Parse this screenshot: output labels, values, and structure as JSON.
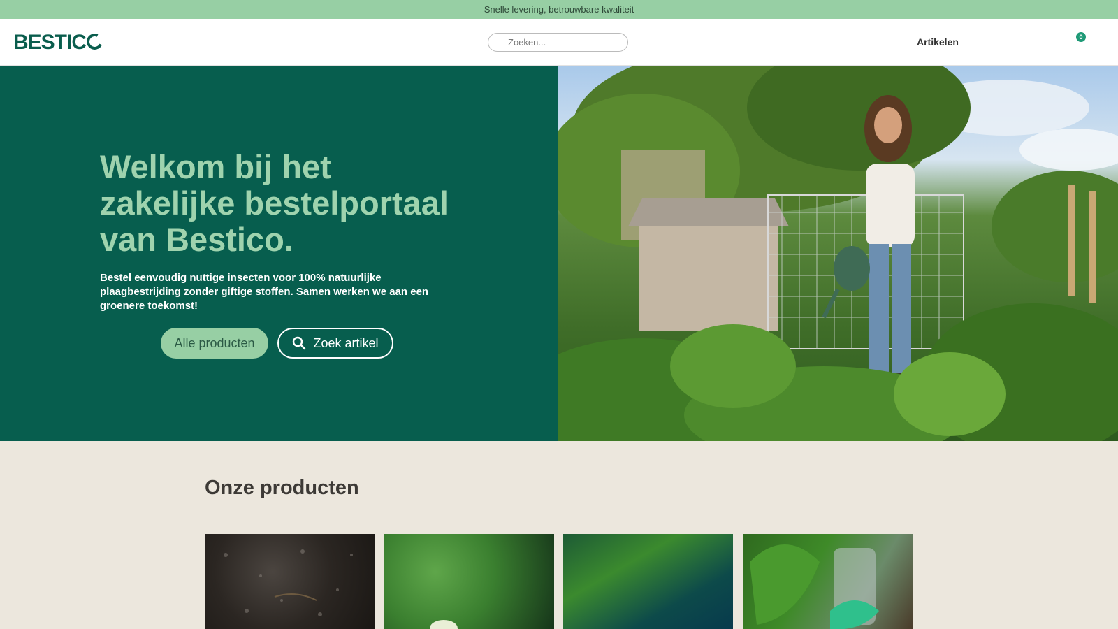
{
  "topbar": {
    "text": "Snelle levering, betrouwbare kwaliteit"
  },
  "header": {
    "logo": "BESTIC",
    "search_placeholder": "Zoeken...",
    "nav_articles": "Artikelen",
    "cart_count": "0"
  },
  "hero": {
    "title_lines": [
      "Welkom bij het",
      "zakelijke bestelportaal",
      "van Bestico."
    ],
    "text": "Bestel eenvoudig nuttige insecten voor 100% natuurlijke plaagbestrijding zonder giftige stoffen. Samen werken we aan een groenere toekomst!",
    "btn_all_products": "Alle producten",
    "btn_search_article": "Zoek artikel"
  },
  "products": {
    "title": "Onze producten"
  },
  "colors": {
    "brand_dark": "#075e4e",
    "brand_light": "#97cfa4",
    "background": "#ece7dd"
  }
}
